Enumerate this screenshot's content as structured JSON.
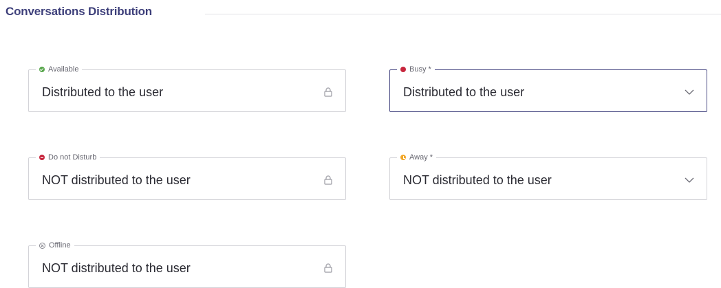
{
  "section": {
    "title": "Conversations Distribution"
  },
  "fields": {
    "available": {
      "label": "Available",
      "value": "Distributed to the user",
      "status_color": "#57a64b",
      "icon": "lock-icon",
      "locked": true
    },
    "busy": {
      "label": "Busy *",
      "value": "Distributed to the user",
      "status_color": "#c7263d",
      "icon": "chevron-down-icon",
      "locked": false
    },
    "do_not_disturb": {
      "label": "Do not Disturb",
      "value": "NOT distributed to the user",
      "status_color": "#c7263d",
      "icon": "lock-icon",
      "locked": true
    },
    "away": {
      "label": "Away *",
      "value": "NOT distributed to the user",
      "status_color": "#f2a82a",
      "icon": "chevron-down-icon",
      "locked": false
    },
    "offline": {
      "label": "Offline",
      "value": "NOT distributed to the user",
      "status_color": "#8a8a92",
      "icon": "lock-icon",
      "locked": true
    }
  }
}
